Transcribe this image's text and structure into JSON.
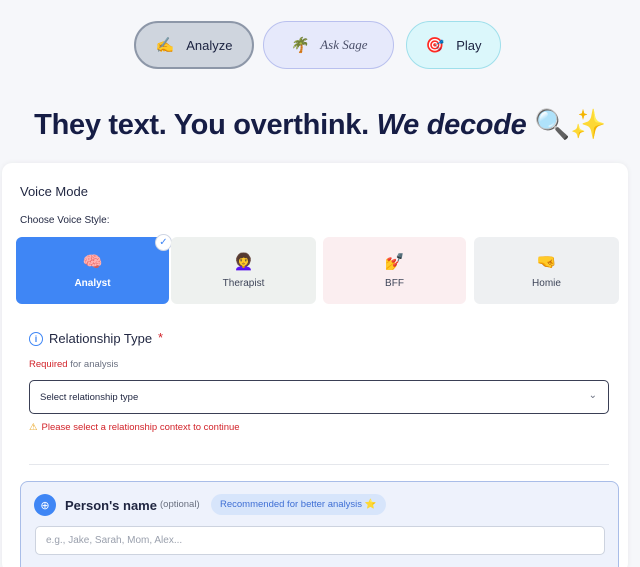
{
  "nav": {
    "analyze": {
      "icon": "✍️",
      "label": "Analyze"
    },
    "ask_sage": {
      "icon": "🌴",
      "label": "Ask Sage"
    },
    "play": {
      "icon": "🎯",
      "label": "Play"
    }
  },
  "headline": {
    "part1": "They text. You overthink. ",
    "part2": "We decode",
    "emoji": " 🔍✨"
  },
  "voice_mode": {
    "title": "Voice Mode",
    "subtitle": "Choose Voice Style:",
    "options": [
      {
        "icon": "🧠",
        "label": "Analyst",
        "selected": true
      },
      {
        "icon": "👩‍🦱",
        "label": "Therapist",
        "selected": false
      },
      {
        "icon": "💅",
        "label": "BFF",
        "selected": false
      },
      {
        "icon": "🤜",
        "label": "Homie",
        "selected": false
      }
    ],
    "check": "✓"
  },
  "relationship": {
    "info_icon": "i",
    "title": "Relationship Type",
    "required_star": "*",
    "required_word": "Required",
    "required_rest": " for analysis",
    "select_value": "Select relationship type",
    "chevron": "⌄",
    "warning_icon": "⚠",
    "warning": "Please select a relationship context to continue"
  },
  "person": {
    "icon": "⊕",
    "title": "Person's name",
    "optional": "(optional)",
    "badge": "Recommended for better analysis ⭐",
    "placeholder": "e.g., Jake, Sarah, Mom, Alex..."
  },
  "colors": {
    "accent": "#3f86f5",
    "error": "#d2232a",
    "headline": "#161d45"
  }
}
